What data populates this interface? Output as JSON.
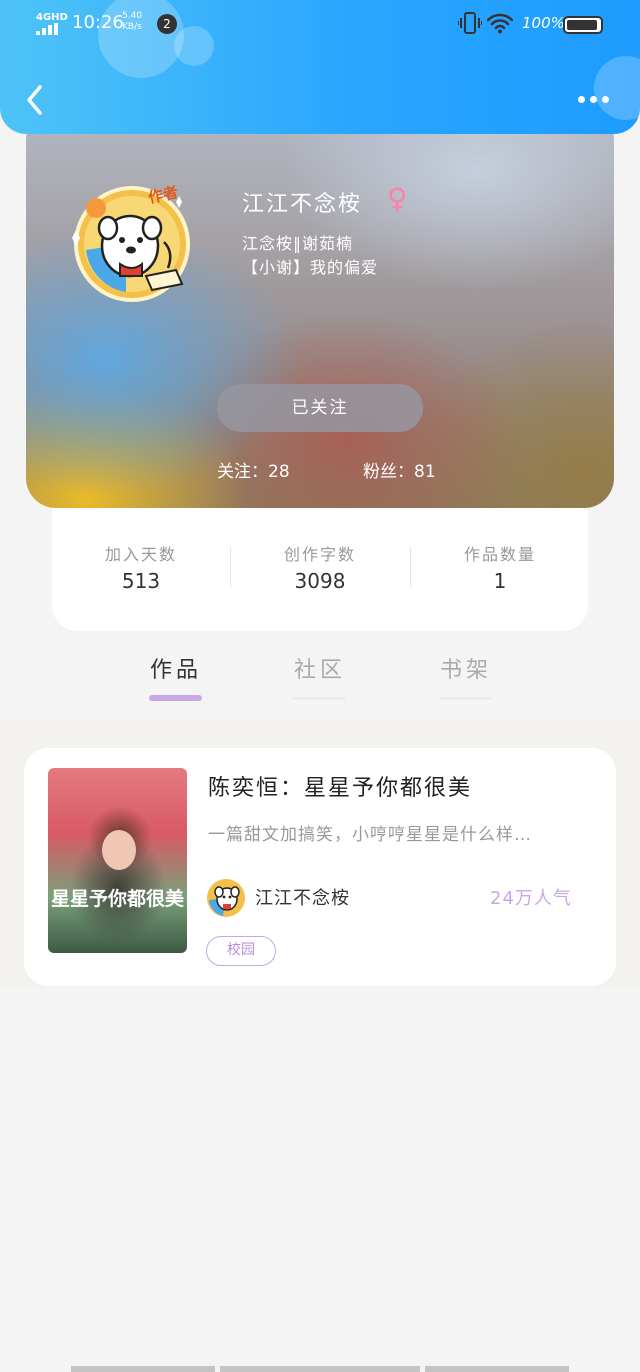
{
  "status_bar": {
    "network": "4GHD",
    "time": "10:26",
    "speed_value": "5.40",
    "speed_unit": "KB/s",
    "notification_count": "2",
    "battery": "100%"
  },
  "header": {
    "back_icon": "chevron-left-icon",
    "more_icon": "more-horizontal-icon"
  },
  "profile": {
    "author_badge": "作者",
    "username": "江江不念桉",
    "gender_symbol": "♀",
    "bio_line1": "江念桉‖谢茹楠",
    "bio_line2": "【小谢】我的偏爱",
    "follow_button": "已关注",
    "following": "关注：28",
    "followers": "粉丝：81"
  },
  "stats": [
    {
      "label": "加入天数",
      "value": "513"
    },
    {
      "label": "创作字数",
      "value": "3098"
    },
    {
      "label": "作品数量",
      "value": "1"
    }
  ],
  "tabs": [
    {
      "label": "作品",
      "active": true
    },
    {
      "label": "社区",
      "active": false
    },
    {
      "label": "书架",
      "active": false
    }
  ],
  "works": [
    {
      "cover_text": "星星予你都很美",
      "title": "陈奕恒：星星予你都很美",
      "description": "一篇甜文加搞笑，小哼哼星星是什么样…",
      "author": "江江不念桉",
      "popularity": "24万人气",
      "tag": "校园"
    }
  ],
  "colors": {
    "header_blue": "#29a6ff",
    "accent_purple": "#c9a7e6",
    "gender_pink": "#ff7fa8"
  }
}
